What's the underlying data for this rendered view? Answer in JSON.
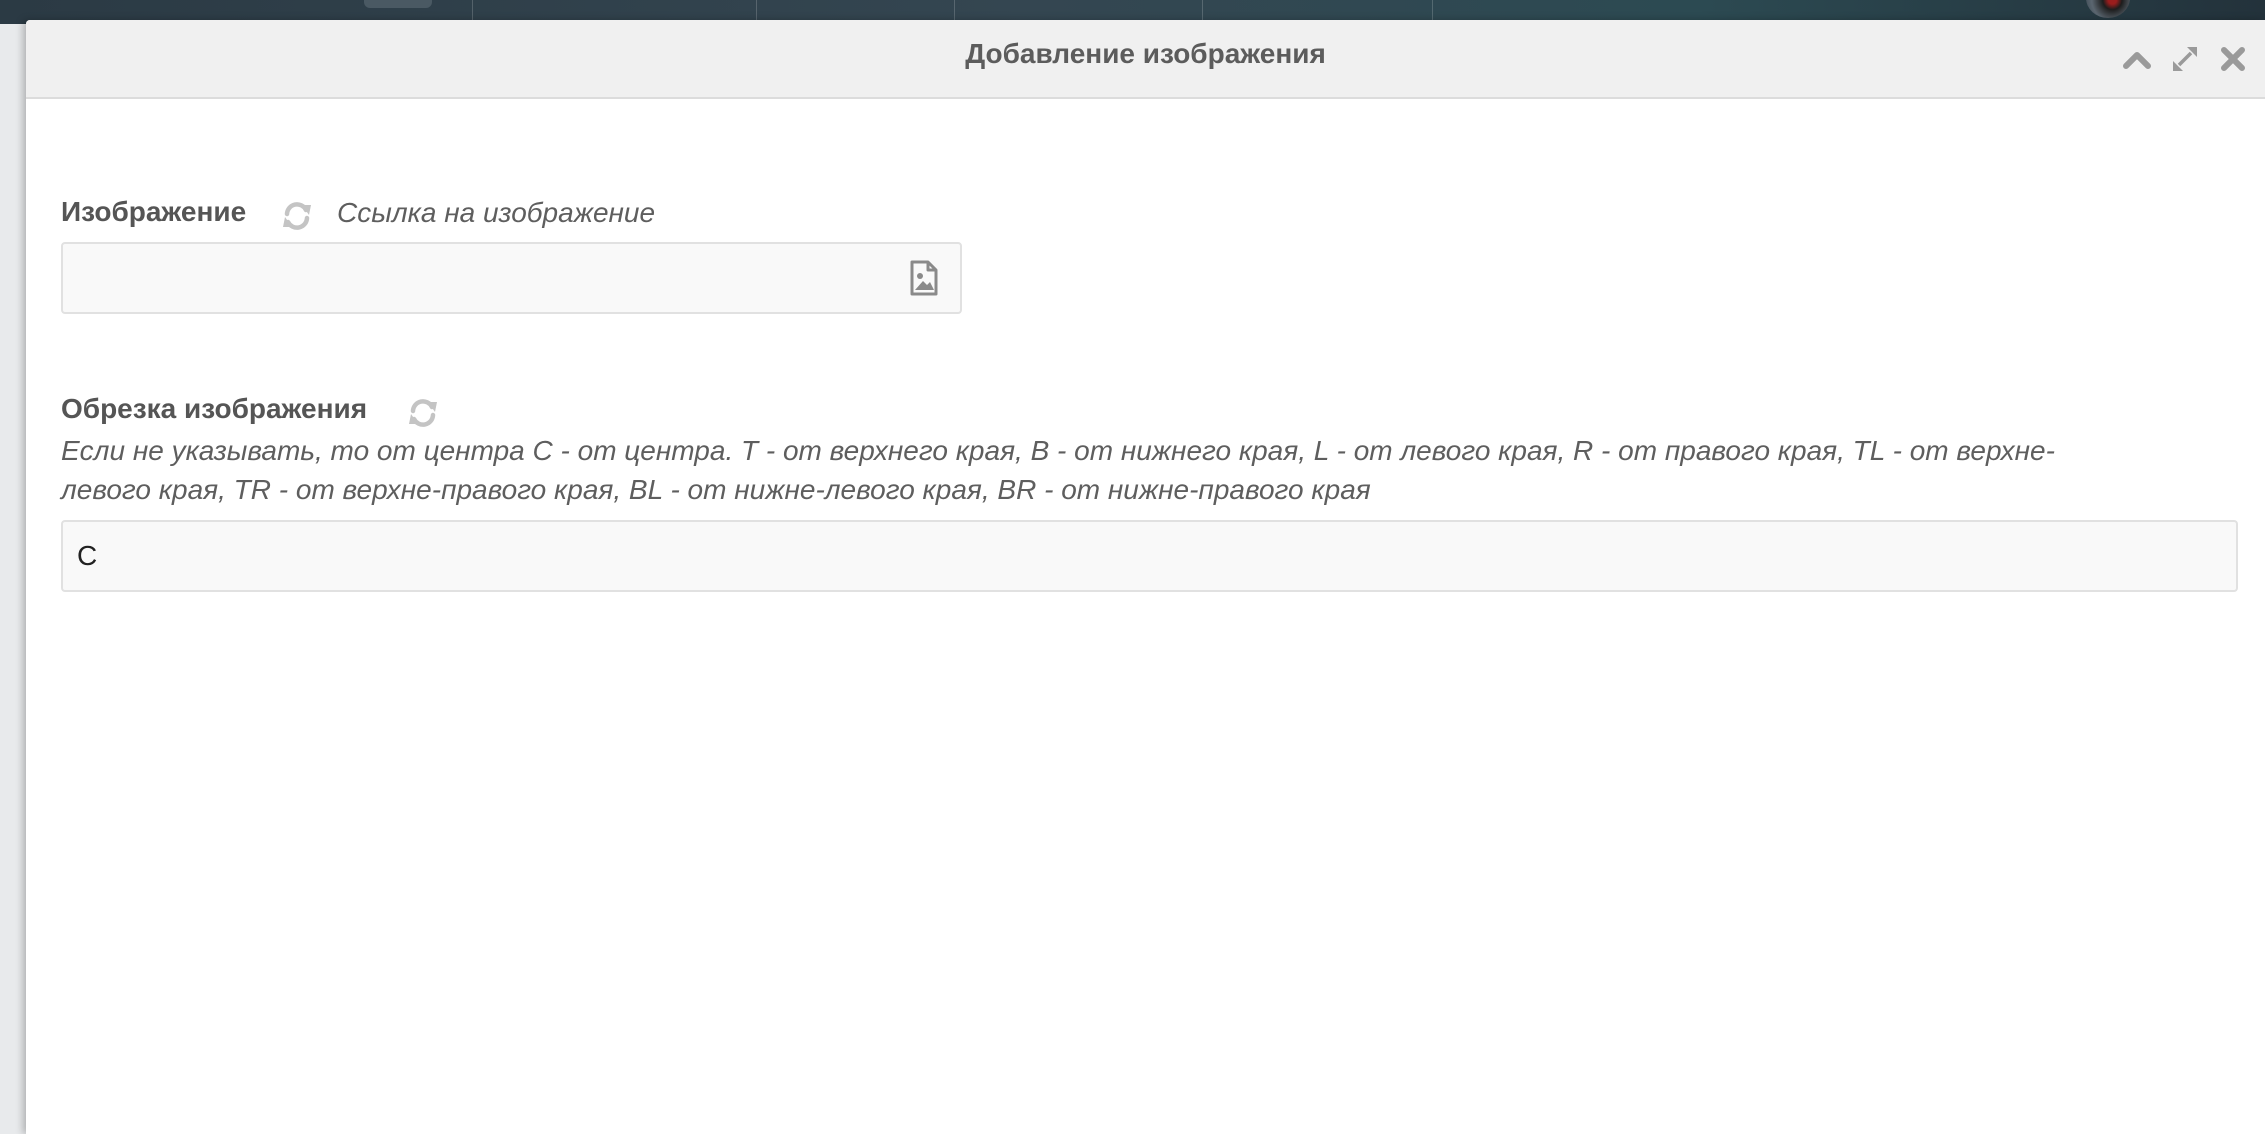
{
  "dialog": {
    "title": "Добавление изображения",
    "icons": {
      "collapse": "chevron-up-icon",
      "expand": "expand-icon",
      "close": "close-icon"
    }
  },
  "image_field": {
    "label": "Изображение",
    "hint": "Ссылка на изображение",
    "value": "",
    "icon": "file-image-icon"
  },
  "crop_field": {
    "label": "Обрезка изображения",
    "hint_line1": "Если не указывать, то от центра C - от центра. T - от верхнего края, B - от нижнего края, L - от левого края, R - от правого края, TL - от верхне-",
    "hint_line2": "левого края, TR - от верхне-правого края, BL - от нижне-левого края, BR - от нижне-правого края",
    "value": "C"
  },
  "colors": {
    "header_bg": "#f0f0f0",
    "text": "#555555",
    "icon": "#9a9a9a"
  }
}
